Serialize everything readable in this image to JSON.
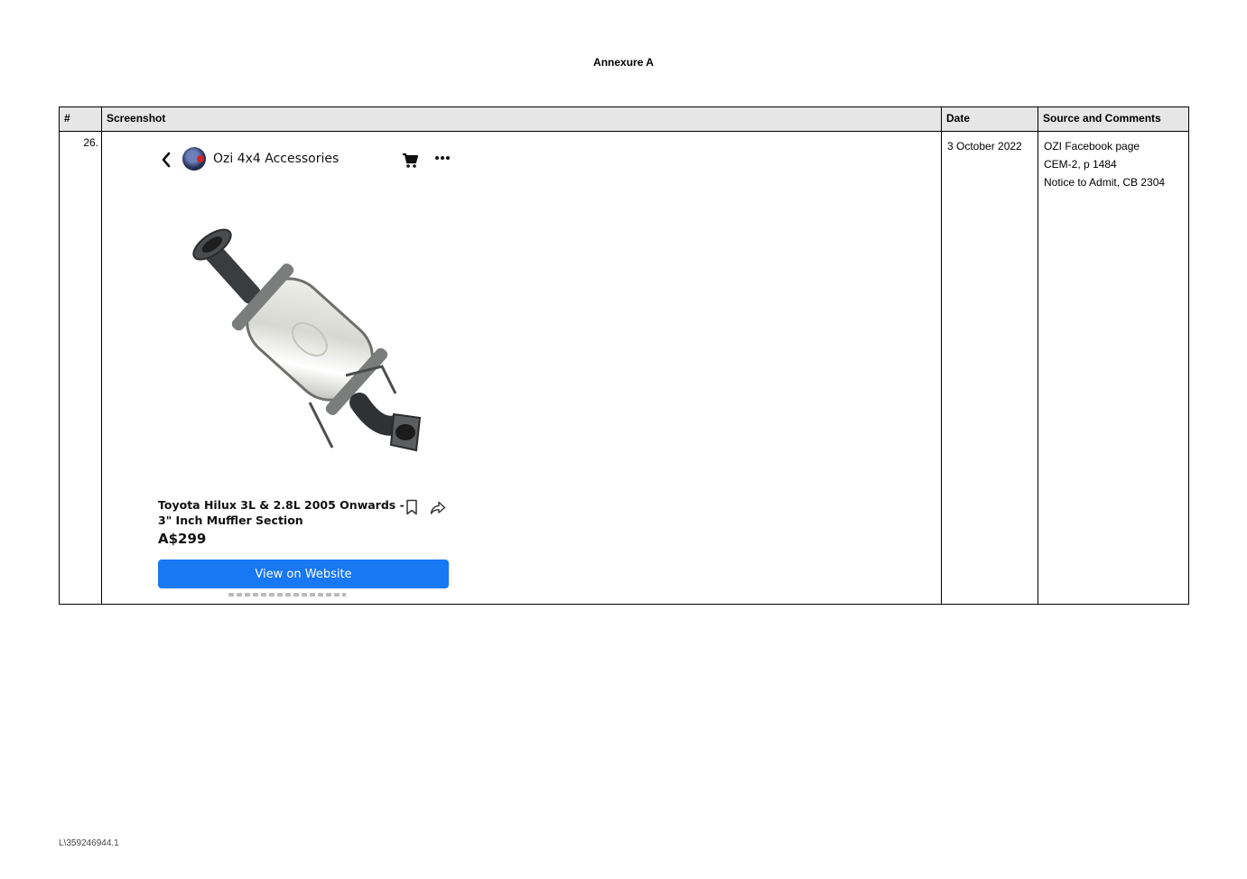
{
  "document": {
    "title": "Annexure A",
    "footer_ref": "L\\359246944.1"
  },
  "table": {
    "headers": {
      "number": "#",
      "screenshot": "Screenshot",
      "date": "Date",
      "source": "Source and Comments"
    },
    "rows": [
      {
        "number": "26.",
        "date": "3 October 2022",
        "source_lines": [
          "OZI Facebook page",
          "CEM-2, p 1484",
          "Notice to Admit, CB 2304"
        ],
        "screenshot": {
          "page_name": "Ozi 4x4 Accessories",
          "product_name_line1": "Toyota Hilux 3L & 2.8L 2005 Onwards -",
          "product_name_line2": "3\" Inch Muffler Section",
          "price": "A$299",
          "cta_label": "View on Website",
          "cta_color": "#1877f2",
          "icons": [
            "back-chevron-icon",
            "cart-icon",
            "more-icon",
            "save-icon",
            "share-icon"
          ]
        }
      }
    ]
  }
}
